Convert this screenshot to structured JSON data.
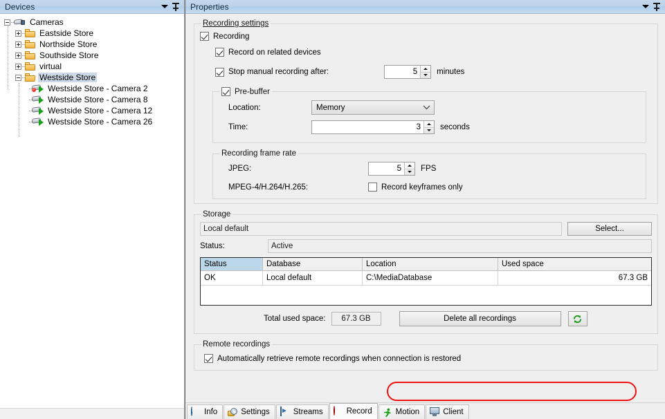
{
  "devices_panel": {
    "title": "Devices",
    "collapse_icon": "chevron-down-icon",
    "pin_icon": "pin-icon",
    "tree": [
      {
        "label": "Cameras",
        "level": 0,
        "icon": "cameras-group-icon",
        "expander": "minus",
        "selected": false
      },
      {
        "label": "Eastside Store",
        "level": 1,
        "icon": "folder-icon",
        "expander": "plus",
        "selected": false
      },
      {
        "label": "Northside Store",
        "level": 1,
        "icon": "folder-icon",
        "expander": "plus",
        "selected": false
      },
      {
        "label": "Southside Store",
        "level": 1,
        "icon": "folder-icon",
        "expander": "plus",
        "selected": false
      },
      {
        "label": "virtual",
        "level": 1,
        "icon": "folder-icon",
        "expander": "plus",
        "selected": false
      },
      {
        "label": "Westside Store",
        "level": 1,
        "icon": "folder-open-icon",
        "expander": "minus",
        "selected": true
      },
      {
        "label": "Westside Store - Camera 2",
        "level": 2,
        "icon": "camera-recording-icon",
        "expander": "none",
        "selected": false
      },
      {
        "label": "Westside Store - Camera 8",
        "level": 2,
        "icon": "camera-icon",
        "expander": "none",
        "selected": false
      },
      {
        "label": "Westside Store - Camera 12",
        "level": 2,
        "icon": "camera-icon",
        "expander": "none",
        "selected": false
      },
      {
        "label": "Westside Store - Camera 26",
        "level": 2,
        "icon": "camera-icon",
        "expander": "none",
        "selected": false
      }
    ]
  },
  "properties_panel": {
    "title": "Properties",
    "collapse_icon": "chevron-down-icon",
    "pin_icon": "pin-icon",
    "recording_settings": {
      "legend": "Recording settings",
      "recording": {
        "label": "Recording",
        "checked": true
      },
      "record_on_related": {
        "label": "Record on related devices",
        "checked": true
      },
      "stop_manual": {
        "label": "Stop manual recording after:",
        "checked": true,
        "value": "5",
        "unit": "minutes"
      },
      "prebuffer": {
        "legend": "Pre-buffer",
        "checked": true,
        "location_label": "Location:",
        "location_value": "Memory",
        "time_label": "Time:",
        "time_value": "3",
        "time_unit": "seconds"
      },
      "frame_rate": {
        "legend": "Recording frame rate",
        "jpeg_label": "JPEG:",
        "jpeg_value": "5",
        "jpeg_unit": "FPS",
        "mpeg_label": "MPEG-4/H.264/H.265:",
        "keyframes_label": "Record keyframes only",
        "keyframes_checked": false
      }
    },
    "storage": {
      "legend": "Storage",
      "storage_name": "Local default",
      "select_button": "Select...",
      "status_label": "Status:",
      "status_value": "Active",
      "table": {
        "columns": [
          "Status",
          "Database",
          "Location",
          "Used space"
        ],
        "rows": [
          {
            "status": "OK",
            "database": "Local default",
            "location": "C:\\MediaDatabase",
            "used_space": "67.3 GB"
          }
        ]
      },
      "total_label": "Total used space:",
      "total_value": "67.3 GB",
      "delete_button": "Delete all recordings",
      "refresh_icon": "refresh-icon"
    },
    "remote_recordings": {
      "legend": "Remote recordings",
      "auto_retrieve": {
        "label": "Automatically retrieve remote recordings when connection is restored",
        "checked": true,
        "highlight_color": "#ee1111"
      }
    },
    "tabs": [
      {
        "label": "Info",
        "icon": "info-icon",
        "active": false
      },
      {
        "label": "Settings",
        "icon": "settings-gear-icon",
        "active": false
      },
      {
        "label": "Streams",
        "icon": "film-play-icon",
        "active": false
      },
      {
        "label": "Record",
        "icon": "record-dot-icon",
        "active": true
      },
      {
        "label": "Motion",
        "icon": "running-person-icon",
        "active": false
      },
      {
        "label": "Client",
        "icon": "monitor-icon",
        "active": false
      }
    ]
  },
  "theme": {
    "caption_blue": "#bdd3e9",
    "panel_bg": "#efefef",
    "selection_blue": "#cdd9e6",
    "table_header_blue": "#bcd6ea",
    "accent_red": "#ee1111",
    "accent_green": "#19a019"
  }
}
